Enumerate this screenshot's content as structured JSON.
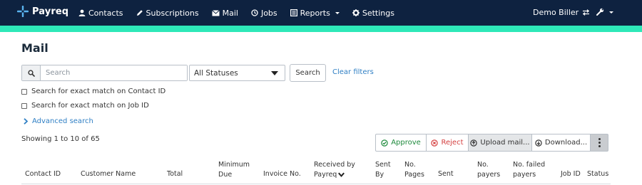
{
  "brand": {
    "name": "Payreq",
    "accent": "#2ee8b8",
    "nav_bg": "#0e2240"
  },
  "nav": {
    "items": [
      {
        "label": "Contacts",
        "icon": "user-icon"
      },
      {
        "label": "Subscriptions",
        "icon": "pencil-icon"
      },
      {
        "label": "Mail",
        "icon": "envelope-icon"
      },
      {
        "label": "Jobs",
        "icon": "clock-icon"
      },
      {
        "label": "Reports",
        "icon": "report-icon"
      },
      {
        "label": "Settings",
        "icon": "gear-icon"
      }
    ],
    "biller_label": "Demo Biller",
    "tools_icon": "wrench-icon"
  },
  "page": {
    "title": "Mail"
  },
  "search": {
    "placeholder": "Search",
    "status_selected": "All Statuses",
    "search_button": "Search",
    "clear_filters": "Clear filters",
    "exact_contact_id": "Search for exact match on Contact ID",
    "exact_job_id": "Search for exact match on Job ID",
    "advanced_search": "Advanced search"
  },
  "results": {
    "showing": "Showing 1 to 10 of 65"
  },
  "actions": {
    "approve": "Approve",
    "reject": "Reject",
    "upload": "Upload mail...",
    "download": "Download..."
  },
  "table": {
    "headers": {
      "contact_id": "Contact ID",
      "customer_name": "Customer Name",
      "total": "Total",
      "minimum_due_1": "Minimum",
      "minimum_due_2": "Due",
      "invoice_no": "Invoice No.",
      "received_by_1": "Received by",
      "received_by_2": "Payreq",
      "sent_by_1": "Sent",
      "sent_by_2": "By",
      "no_pages_1": "No.",
      "no_pages_2": "Pages",
      "sent": "Sent",
      "no_payers_1": "No.",
      "no_payers_2": "payers",
      "no_failed_payers_1": "No. failed",
      "no_failed_payers_2": "payers",
      "job_id": "Job ID",
      "status": "Status"
    }
  }
}
